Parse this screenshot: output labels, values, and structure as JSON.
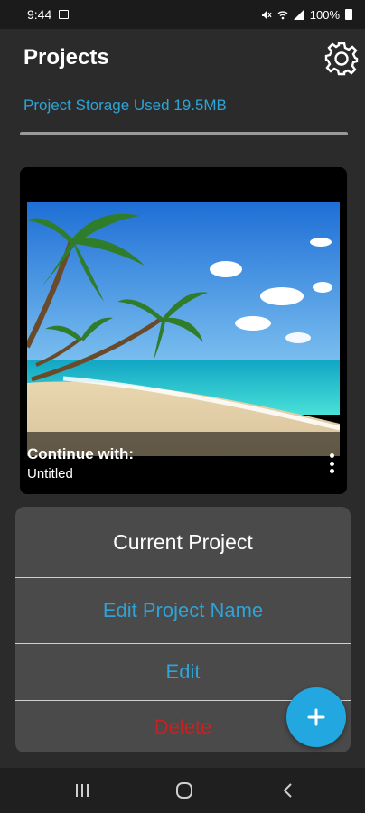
{
  "status_bar": {
    "time": "9:44",
    "battery": "100%",
    "icons": [
      "image-icon",
      "mute-icon",
      "wifi-icon",
      "signal-icon",
      "battery-icon"
    ]
  },
  "app_bar": {
    "title": "Projects",
    "settings_icon": "gear-icon"
  },
  "storage": {
    "text": "Project Storage Used 19.5MB"
  },
  "card": {
    "continue_label": "Continue with:",
    "project_name": "Untitled",
    "more_icon": "more-vertical-icon"
  },
  "sheet": {
    "title": "Current Project",
    "edit_name_label": "Edit Project Name",
    "edit_label": "Edit",
    "delete_label": "Delete"
  },
  "fab": {
    "icon": "plus-icon"
  },
  "nav": {
    "recents_icon": "recents-icon",
    "home_icon": "home-icon",
    "back_icon": "back-icon"
  },
  "colors": {
    "background": "#2b2b2b",
    "accent_blue": "#2ea3d6",
    "fab_blue": "#22a7e0",
    "delete_red": "#cc1f1f",
    "sheet_bg": "#4a4a4a"
  }
}
